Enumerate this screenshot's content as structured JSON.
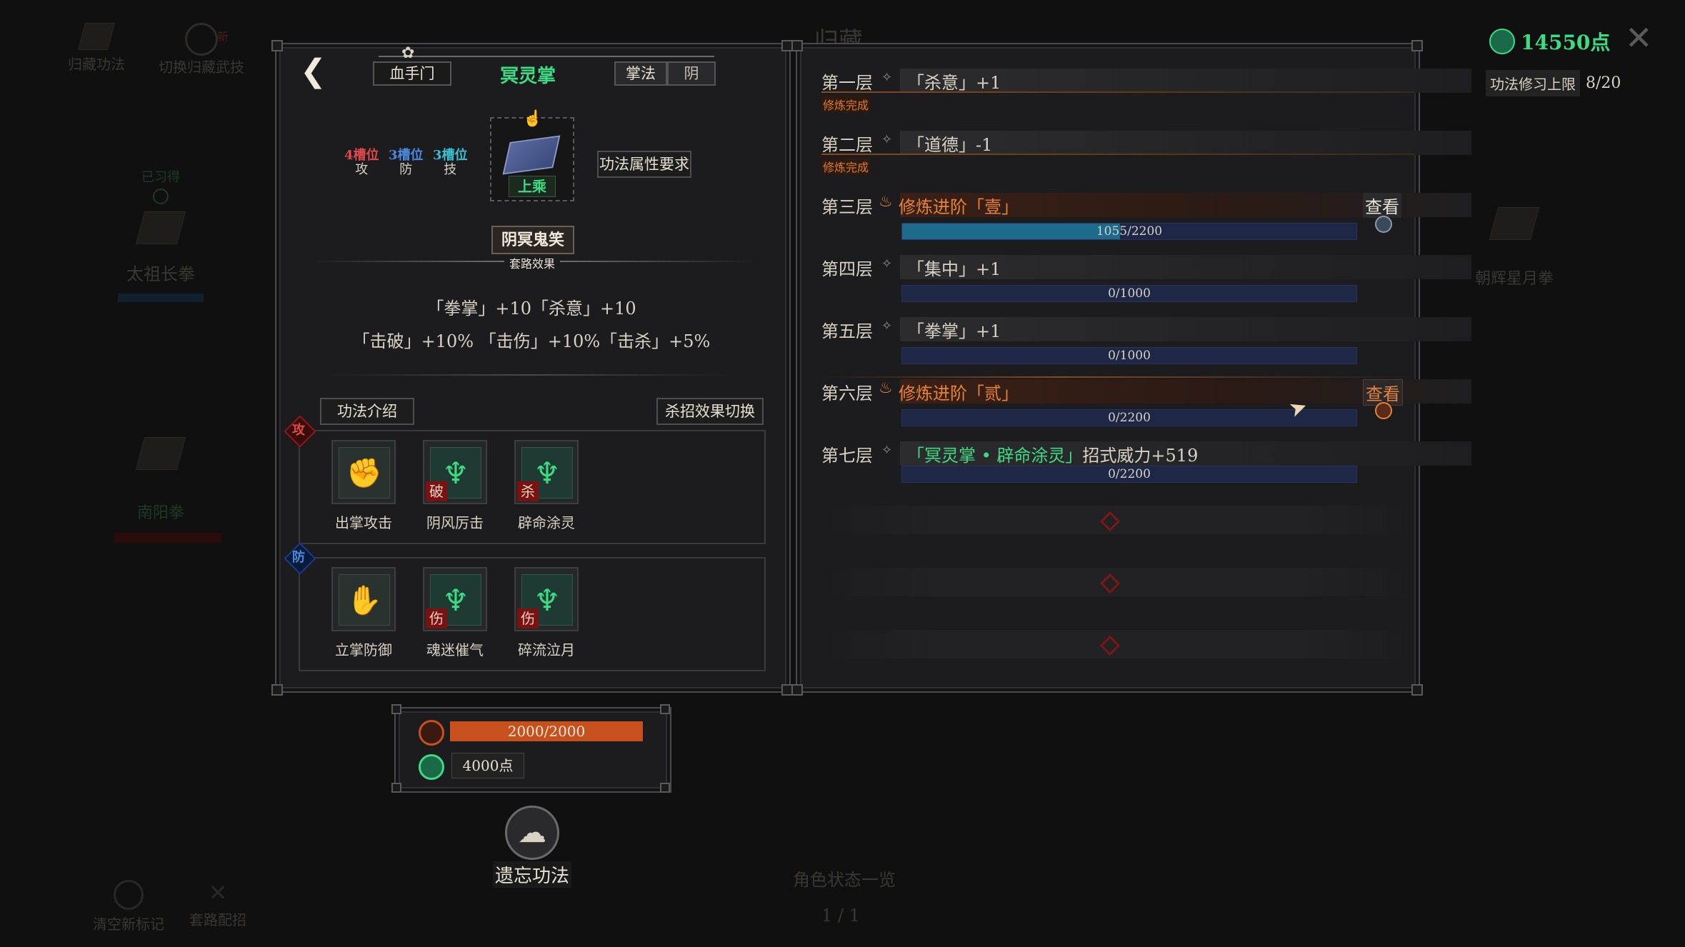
{
  "background": {
    "top_left": [
      "归藏功法",
      "切换归藏武技"
    ],
    "new_badge": "新",
    "title": "归藏",
    "left_items": [
      {
        "status": "已习得",
        "name": "太祖长拳"
      },
      {
        "name": "南阳拳"
      }
    ],
    "right_item": "朝辉星月拳",
    "bottom_left": [
      "清空新标记",
      "套路配招"
    ],
    "bottom_center": "角色状态一览",
    "page": "1 / 1"
  },
  "currency": {
    "points": "14550点",
    "limit_label": "功法修习上限",
    "limit_value": "8/20"
  },
  "header": {
    "sect": "血手门",
    "title": "冥灵掌",
    "type": "掌法",
    "attr": "阴"
  },
  "book": {
    "slots": [
      {
        "count": "4槽位",
        "label": "攻",
        "color": "#e04a4a"
      },
      {
        "count": "3槽位",
        "label": "防",
        "color": "#4a8ae0"
      },
      {
        "count": "3槽位",
        "label": "技",
        "color": "#3ac0d0"
      }
    ],
    "grade": "上乘",
    "req_button": "功法属性要求"
  },
  "combo": {
    "name": "阴冥鬼笑",
    "subtitle": "套路效果",
    "line1": "「拳掌」+10「杀意」+10",
    "line2": "「击破」+10% 「击伤」+10%「击杀」+5%"
  },
  "buttons": {
    "intro": "功法介绍",
    "switch": "杀招效果切换"
  },
  "attack": {
    "label": "攻",
    "skills": [
      {
        "name": "出掌攻击",
        "icon": "fist-icon",
        "mark": ""
      },
      {
        "name": "阴风厉击",
        "icon": "wind-claw-icon",
        "mark": "破"
      },
      {
        "name": "辟命涂灵",
        "icon": "wind-claw-icon",
        "mark": "杀"
      }
    ]
  },
  "defense": {
    "label": "防",
    "skills": [
      {
        "name": "立掌防御",
        "icon": "palm-block-icon",
        "mark": ""
      },
      {
        "name": "魂迷催气",
        "icon": "wind-claw-icon",
        "mark": "伤"
      },
      {
        "name": "碎流泣月",
        "icon": "wind-claw-icon",
        "mark": "伤"
      }
    ]
  },
  "stats": {
    "hp": "2000/2000",
    "hp_fraction": 1.0,
    "cost": "4000点"
  },
  "forget": "遗忘功法",
  "layers": [
    {
      "name": "第一层",
      "text": "「杀意」+1",
      "status": "修炼完成",
      "kind": "normal"
    },
    {
      "name": "第二层",
      "text": "「道德」-1",
      "status": "修炼完成",
      "kind": "normal"
    },
    {
      "name": "第三层",
      "text": "修炼进阶「壹」",
      "progress": "1055/2200",
      "fraction": 0.48,
      "kind": "advance",
      "view": "查看"
    },
    {
      "name": "第四层",
      "text": "「集中」+1",
      "progress": "0/1000",
      "fraction": 0,
      "kind": "normal"
    },
    {
      "name": "第五层",
      "text": "「拳掌」+1",
      "progress": "0/1000",
      "fraction": 0,
      "kind": "normal"
    },
    {
      "name": "第六层",
      "text": "修炼进阶「贰」",
      "progress": "0/2200",
      "fraction": 0,
      "kind": "advance",
      "view": "查看"
    },
    {
      "name": "第七层",
      "text_green": "「冥灵掌 • 辟命涂灵」",
      "text_rest": "招式威力+519",
      "progress": "0/2200",
      "fraction": 0,
      "kind": "final"
    }
  ],
  "colors": {
    "accent_green": "#3ddc84",
    "accent_orange": "#e8823a",
    "hp_red": "#c8501c",
    "bar_blue": "#1c6a8c"
  }
}
